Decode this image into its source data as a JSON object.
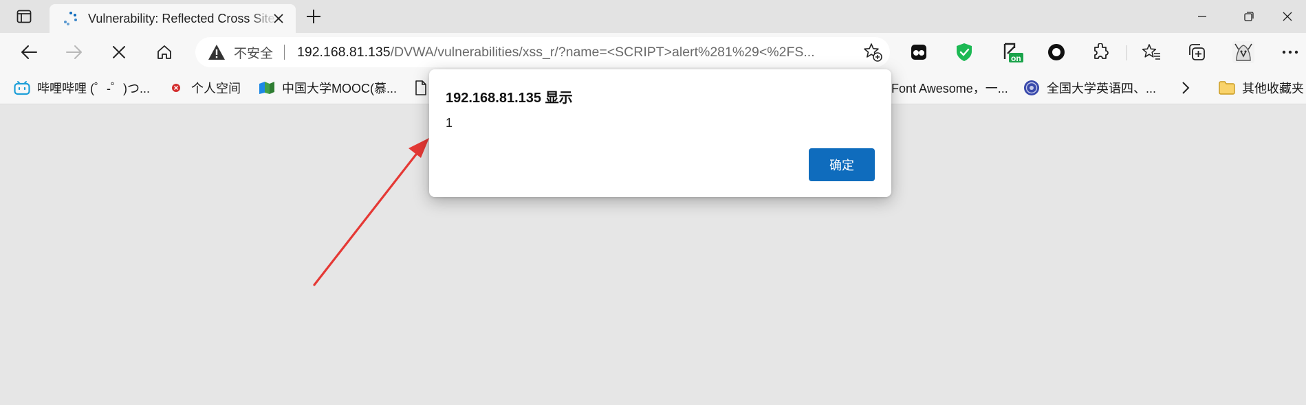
{
  "tab": {
    "title": "Vulnerability: Reflected Cross Site Scripting (XSS) :: Damn Vulnerable Web Application (DVWA)",
    "newtab_icon": "plus-icon"
  },
  "toolbar": {
    "security_label": "不安全",
    "url_host": "192.168.81.135",
    "url_path": "/DVWA/vulnerabilities/xss_r/?name=<SCRIPT>alert%281%29<%2FS...",
    "extensions": [
      "extension-dark-icon",
      "extension-shield-icon",
      "extension-on-icon",
      "extension-circle-icon",
      "extensions-puzzle-icon",
      "favorites-icon",
      "collections-icon",
      "profile-avatar-icon",
      "more-icon"
    ],
    "ext_on_badge": "on"
  },
  "bookmarks": {
    "items": [
      {
        "label": "哔哩哔哩 (゜-゜)つ..."
      },
      {
        "label": "个人空间"
      },
      {
        "label": "中国大学MOOC(慕..."
      },
      {
        "label": "Font Awesome，一..."
      },
      {
        "label": "全国大学英语四、..."
      }
    ],
    "other_folder": "其他收藏夹"
  },
  "dialog": {
    "title": "192.168.81.135 显示",
    "message": "1",
    "ok_label": "确定"
  },
  "colors": {
    "accent": "#0f6cbd",
    "arrow": "#e53935",
    "page_background": "#e6e6e6"
  }
}
